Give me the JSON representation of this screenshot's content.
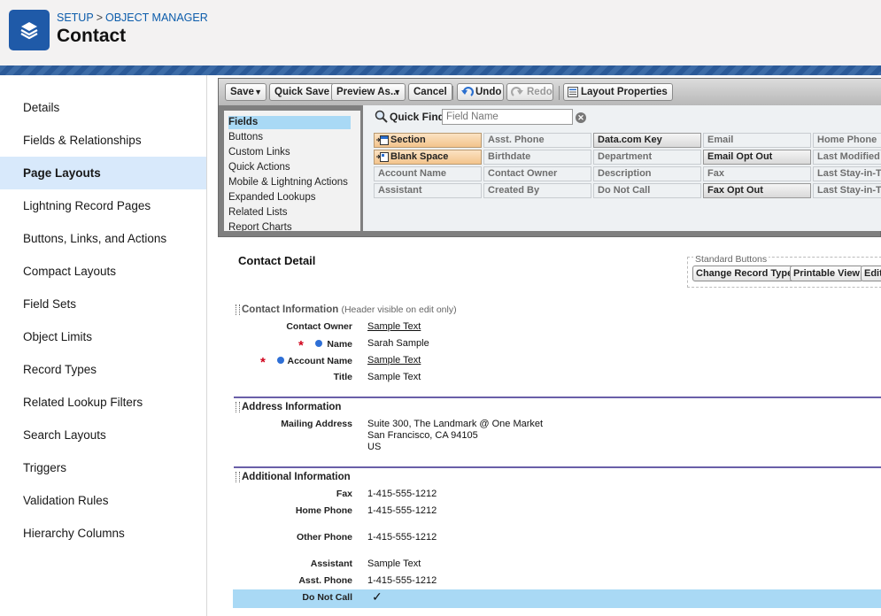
{
  "header": {
    "breadcrumb": [
      "SETUP",
      "OBJECT MANAGER"
    ],
    "breadcrumb_sep": ">",
    "title": "Contact",
    "colors": {
      "brand": "#1f5aa8",
      "band": "#2d5fa0"
    }
  },
  "sidebar": {
    "items": [
      {
        "label": "Details"
      },
      {
        "label": "Fields & Relationships"
      },
      {
        "label": "Page Layouts",
        "active": true
      },
      {
        "label": "Lightning Record Pages"
      },
      {
        "label": "Buttons, Links, and Actions"
      },
      {
        "label": "Compact Layouts"
      },
      {
        "label": "Field Sets"
      },
      {
        "label": "Object Limits"
      },
      {
        "label": "Record Types"
      },
      {
        "label": "Related Lookup Filters"
      },
      {
        "label": "Search Layouts"
      },
      {
        "label": "Triggers"
      },
      {
        "label": "Validation Rules"
      },
      {
        "label": "Hierarchy Columns"
      }
    ]
  },
  "toolbar": {
    "save": "Save",
    "quick_save": "Quick Save",
    "preview_as": "Preview As...",
    "cancel": "Cancel",
    "undo": "Undo",
    "redo": "Redo",
    "layout_properties": "Layout Properties"
  },
  "palette": {
    "categories": [
      "Fields",
      "Buttons",
      "Custom Links",
      "Quick Actions",
      "Mobile & Lightning Actions",
      "Expanded Lookups",
      "Related Lists",
      "Report Charts"
    ],
    "active_category": "Fields",
    "quick_find_label": "Quick Find",
    "quick_find_placeholder": "Field Name",
    "fields": [
      [
        "Section",
        "Asst. Phone",
        "Data.com Key",
        "Email",
        "Home Phone"
      ],
      [
        "Blank Space",
        "Birthdate",
        "Department",
        "Email Opt Out",
        "Last Modified By"
      ],
      [
        "Account Name",
        "Contact Owner",
        "Description",
        "Fax",
        "Last Stay-in-Touch Request Date"
      ],
      [
        "Assistant",
        "Created By",
        "Do Not Call",
        "Fax Opt Out",
        "Last Stay-in-Touch Save Date"
      ]
    ]
  },
  "detail": {
    "title": "Contact Detail",
    "standard_buttons_label": "Standard Buttons",
    "standard_buttons": [
      "Change Record Type",
      "Printable View",
      "Edit"
    ],
    "sections": {
      "contact": {
        "title": "Contact Information",
        "note": "(Header visible on edit only)",
        "fields": [
          {
            "label": "Contact Owner",
            "value": "Sample Text"
          },
          {
            "label": "Name",
            "value": "Sarah Sample"
          },
          {
            "label": "Account Name",
            "value": "Sample Text"
          },
          {
            "label": "Title",
            "value": "Sample Text"
          }
        ]
      },
      "address": {
        "title": "Address Information",
        "fields": [
          {
            "label": "Mailing Address",
            "value": [
              "Suite 300, The Landmark @ One Market",
              "San Francisco, CA 94105",
              "US"
            ]
          }
        ]
      },
      "additional": {
        "title": "Additional Information",
        "fields": [
          {
            "label": "Fax",
            "value": "1-415-555-1212"
          },
          {
            "label": "Home Phone",
            "value": "1-415-555-1212"
          },
          {
            "label": "Other Phone",
            "value": "1-415-555-1212"
          },
          {
            "label": "Assistant",
            "value": "Sample Text"
          },
          {
            "label": "Asst. Phone",
            "value": "1-415-555-1212"
          },
          {
            "label": "Do Not Call",
            "value": "✓"
          }
        ]
      }
    }
  }
}
